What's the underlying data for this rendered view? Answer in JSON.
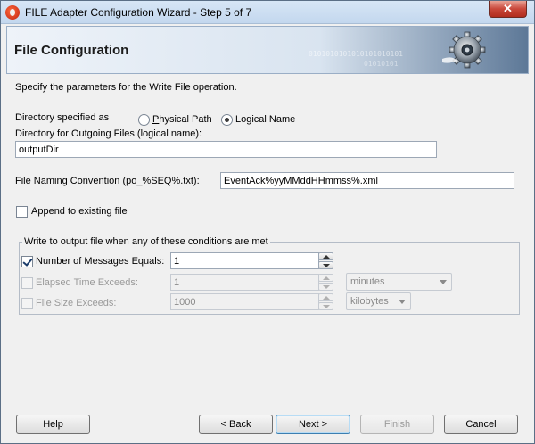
{
  "window": {
    "title": "FILE Adapter Configuration Wizard - Step 5 of 7",
    "close_label": "✕"
  },
  "header": {
    "title": "File Configuration",
    "binary_line1": "0101010101010101010101",
    "binary_line2": "01010101"
  },
  "description": "Specify the parameters for the Write File operation.",
  "directory": {
    "label": "Directory specified as",
    "options": [
      "Physical Path",
      "Logical Name"
    ],
    "selected": "Logical Name",
    "outgoing_label": "Directory for Outgoing Files (logical name):",
    "outgoing_value": "outputDir"
  },
  "naming": {
    "label": "File Naming Convention (po_%SEQ%.txt):",
    "value": "EventAck%yyMMddHHmmss%.xml"
  },
  "append": {
    "label": "Append to existing file",
    "checked": false
  },
  "conditions": {
    "legend": "Write to output file when any of these conditions are met",
    "messages": {
      "label": "Number of Messages Equals:",
      "checked": true,
      "value": "1"
    },
    "elapsed": {
      "label": "Elapsed Time Exceeds:",
      "checked": false,
      "value": "1",
      "unit": "minutes"
    },
    "size": {
      "label": "File Size Exceeds:",
      "checked": false,
      "value": "1000",
      "unit": "kilobytes"
    }
  },
  "buttons": {
    "help": "Help",
    "back": "< Back",
    "next": "Next >",
    "finish": "Finish",
    "cancel": "Cancel"
  },
  "colors": {
    "title_bar": "#c3d7ee",
    "close_button": "#c9473a",
    "header_gradient_end": "#5d7897",
    "default_button_border": "#3c7fb1"
  }
}
